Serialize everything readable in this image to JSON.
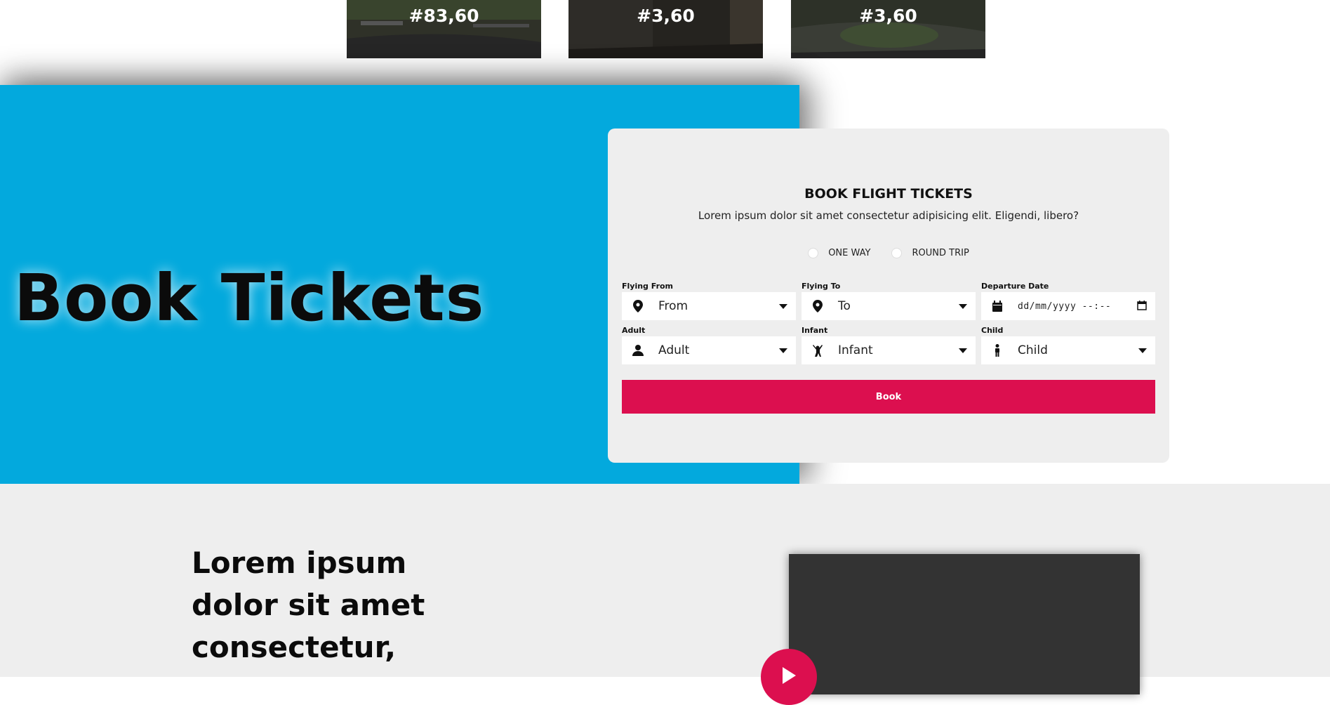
{
  "cards": [
    {
      "price": "#83,60"
    },
    {
      "price": "#3,60"
    },
    {
      "price": "#3,60"
    }
  ],
  "hero": {
    "title": "Book Tickets"
  },
  "booking": {
    "title": "BOOK FLIGHT TICKETS",
    "subtitle": "Lorem ipsum dolor sit amet consectetur adipisicing elit. Eligendi, libero?",
    "trip_options": [
      "ONE WAY",
      "ROUND TRIP"
    ],
    "fields": {
      "flying_from": {
        "label": "Flying From",
        "value": "From",
        "icon": "map-pin-icon"
      },
      "flying_to": {
        "label": "Flying To",
        "value": "To",
        "icon": "map-pin-icon"
      },
      "departure": {
        "label": "Departure Date",
        "value": "dd/mm/yyyy --:--",
        "icon": "calendar-icon"
      },
      "adult": {
        "label": "Adult",
        "value": "Adult",
        "icon": "person-icon"
      },
      "infant": {
        "label": "Infant",
        "value": "Infant",
        "icon": "child-icon"
      },
      "child": {
        "label": "Child",
        "value": "Child",
        "icon": "child-standing-icon"
      }
    },
    "button": "Book"
  },
  "lower": {
    "heading": "Lorem ipsum dolor sit amet consectetur,"
  },
  "colors": {
    "hero_blue": "#03a9dd",
    "accent": "#dc0f4f",
    "panel": "#eeeeee"
  }
}
